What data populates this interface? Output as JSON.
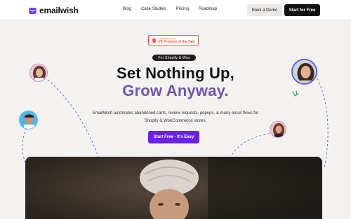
{
  "header": {
    "brand": "emailwish",
    "nav": [
      "Blog",
      "Case Studies",
      "Pricing",
      "Roadmap"
    ],
    "demo_label": "Book a Demo",
    "start_label": "Start for Free"
  },
  "badge": {
    "top": "PRODUCT HUNT",
    "main": "#5 Product of the Day"
  },
  "hero": {
    "pill": "For Shopify & Woo",
    "title_line1": "Set Nothing Up,",
    "title_line2": "Grow Anyway.",
    "subtitle": "EmailWish automates abandoned carts, review requests, popups, & many email flows for Shopify & WooCommerce stores.",
    "cta": "Start Free - It's Easy"
  },
  "colors": {
    "accent_purple": "#6a22e6",
    "title_purple": "#6e57a8",
    "producthunt_orange": "#e05a3b",
    "dark": "#111111"
  }
}
